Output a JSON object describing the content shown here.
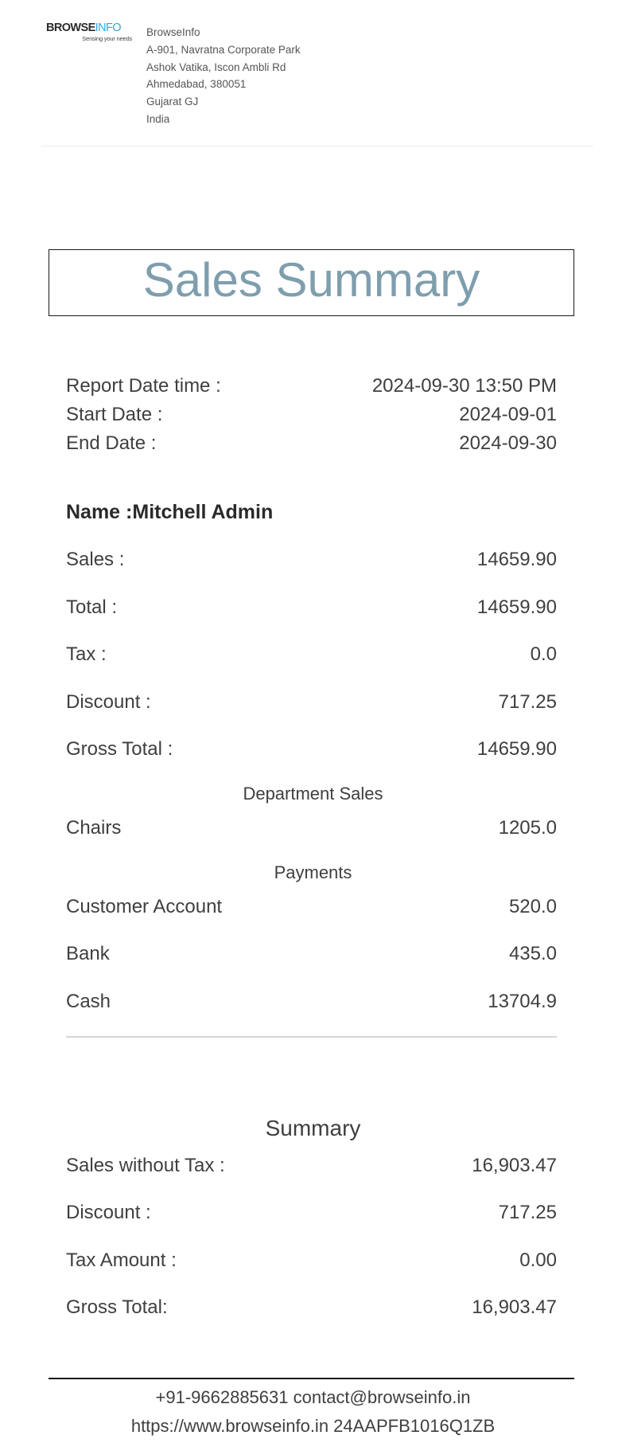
{
  "company": {
    "logo_text_main": "BROWSE",
    "logo_text_accent": "INFO",
    "logo_tagline": "Sensing your needs",
    "name": "BrowseInfo",
    "address_line1": "A-901, Navratna Corporate Park",
    "address_line2": "Ashok Vatika, Iscon Ambli Rd",
    "address_line3": "Ahmedabad, 380051",
    "address_line4": "Gujarat GJ",
    "address_line5": "India",
    "logo_accent_color": "#3aa2d8"
  },
  "report": {
    "title": "Sales Summary",
    "title_color": "#7f9ead",
    "report_datetime_label": "Report Date time :",
    "report_datetime_value": "2024-09-30 13:50 PM",
    "start_date_label": "Start Date :",
    "start_date_value": "2024-09-01",
    "end_date_label": "End Date :",
    "end_date_value": "2024-09-30"
  },
  "user": {
    "name_label": "Name :",
    "name_value": "Mitchell Admin"
  },
  "totals": [
    {
      "label": "Sales :",
      "value": "14659.90"
    },
    {
      "label": "Total :",
      "value": "14659.90"
    },
    {
      "label": "Tax :",
      "value": "0.0"
    },
    {
      "label": "Discount :",
      "value": "717.25"
    },
    {
      "label": "Gross Total :",
      "value": "14659.90"
    }
  ],
  "department_sales": {
    "heading": "Department Sales",
    "items": [
      {
        "label": "Chairs",
        "value": "1205.0"
      }
    ]
  },
  "payments": {
    "heading": "Payments",
    "items": [
      {
        "label": "Customer Account",
        "value": "520.0"
      },
      {
        "label": "Bank",
        "value": "435.0"
      },
      {
        "label": "Cash",
        "value": "13704.9"
      }
    ]
  },
  "summary": {
    "heading": "Summary",
    "items": [
      {
        "label": "Sales without Tax :",
        "value": "16,903.47"
      },
      {
        "label": "Discount :",
        "value": "717.25"
      },
      {
        "label": "Tax Amount :",
        "value": "0.00"
      },
      {
        "label": "Gross Total:",
        "value": "16,903.47"
      }
    ]
  },
  "footer": {
    "line1": "+91-9662885631 contact@browseinfo.in",
    "line2": "https://www.browseinfo.in 24AAPFB1016Q1ZB"
  }
}
